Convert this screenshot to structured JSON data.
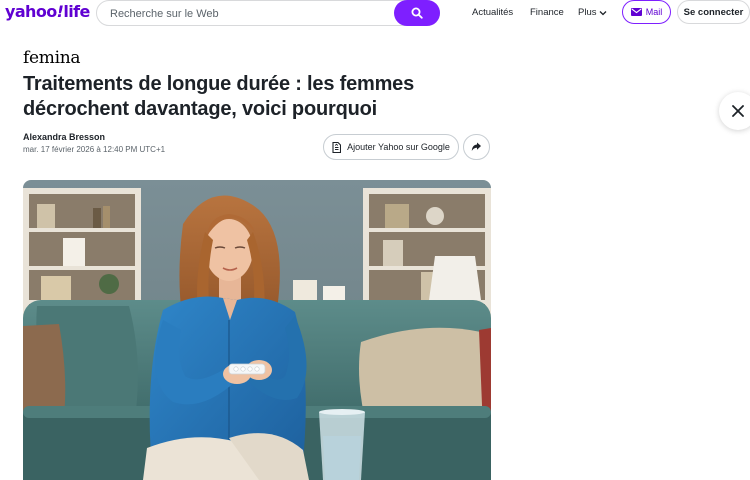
{
  "header": {
    "logo_main": "yahoo",
    "logo_bang": "!",
    "logo_sub": "life",
    "search_placeholder": "Recherche sur le Web",
    "nav": {
      "news": "Actualités",
      "finance": "Finance",
      "more": "Plus"
    },
    "mail_label": "Mail",
    "login_label": "Se connecter"
  },
  "article": {
    "source": "femina",
    "title": "Traitements de longue durée : les femmes décrochent davantage, voici pourquoi",
    "author": "Alexandra Bresson",
    "date": "mar. 17 février 2026 à 12:40 PM UTC+1",
    "google_button_label": "Ajouter Yahoo sur Google"
  },
  "colors": {
    "brand": "#6001d2",
    "search_button": "#7e1fff",
    "text": "#1d2228"
  },
  "icons": [
    "search-icon",
    "chevron-down-icon",
    "mail-icon",
    "google-doc-icon",
    "share-icon",
    "close-icon"
  ]
}
